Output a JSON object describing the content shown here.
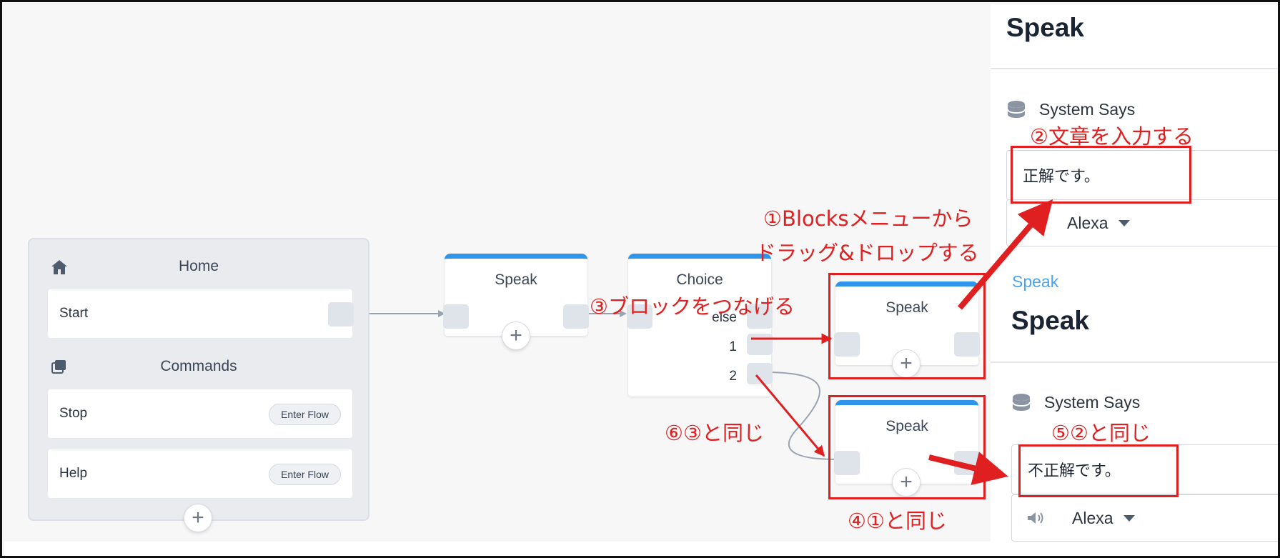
{
  "home": {
    "title": "Home",
    "start_label": "Start",
    "commands_title": "Commands",
    "commands": [
      {
        "label": "Stop",
        "button": "Enter Flow"
      },
      {
        "label": "Help",
        "button": "Enter Flow"
      }
    ]
  },
  "blocks": {
    "speak1": "Speak",
    "choice": "Choice",
    "choice_paths": [
      "else",
      "1",
      "2"
    ],
    "speak2": "Speak",
    "speak3": "Speak"
  },
  "annotations": {
    "step1_line1": "①Blocksメニューから",
    "step1_line2": "ドラッグ&ドロップする",
    "step2": "②文章を入力する",
    "step3": "③ブロックをつなげる",
    "step4": "④①と同じ",
    "step5": "⑤②と同じ",
    "step6": "⑥③と同じ",
    "color": "#e02020"
  },
  "side_panel": {
    "top_title": "Speak",
    "system_says_1": "System Says",
    "text_1": "正解です。",
    "voice_1": "Alexa",
    "breadcrumb": "Speak",
    "title_2": "Speak",
    "system_says_2": "System Says",
    "text_2": "不正解です。",
    "voice_2": "Alexa"
  },
  "colors": {
    "block_accent": "#2f95ea",
    "link": "#4aa3f0"
  }
}
